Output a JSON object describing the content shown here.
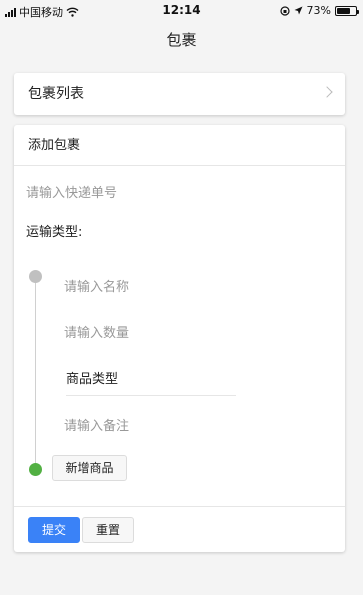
{
  "status_bar": {
    "carrier": "中国移动",
    "time": "12:14",
    "battery": "73%",
    "battery_level": 0.73
  },
  "nav": {
    "title": "包裹"
  },
  "package_list": {
    "title": "包裹列表"
  },
  "form": {
    "title": "添加包裹",
    "tracking_placeholder": "请输入快递单号",
    "transport_label": "运输类型:",
    "item": {
      "name_placeholder": "请输入名称",
      "quantity_placeholder": "请输入数量",
      "type_label": "商品类型",
      "note_placeholder": "请输入备注"
    },
    "add_item_label": "新增商品",
    "submit_label": "提交",
    "reset_label": "重置"
  },
  "colors": {
    "primary": "#3a82f7",
    "timeline_active": "#52b043",
    "timeline_inactive": "#c0c0c0"
  }
}
